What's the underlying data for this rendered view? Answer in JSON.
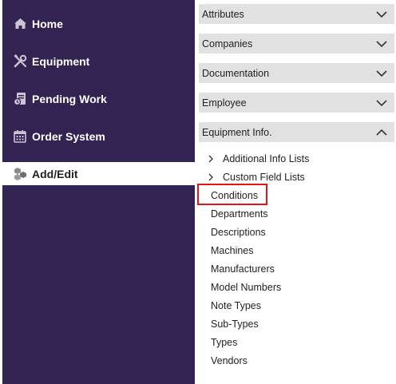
{
  "sidebar": {
    "items": [
      {
        "label": "Home",
        "icon": "home-icon"
      },
      {
        "label": "Equipment",
        "icon": "tools-icon"
      },
      {
        "label": "Pending Work",
        "icon": "pending-work-icon"
      },
      {
        "label": "Order System",
        "icon": "calendar-icon"
      },
      {
        "label": "Add/Edit",
        "icon": "cubes-icon",
        "active": true
      }
    ],
    "background": "#322352"
  },
  "accordion": {
    "sections": [
      {
        "label": "Attributes",
        "expanded": false
      },
      {
        "label": "Companies",
        "expanded": false
      },
      {
        "label": "Documentation",
        "expanded": false
      },
      {
        "label": "Employee",
        "expanded": false
      },
      {
        "label": "Equipment Info.",
        "expanded": true
      }
    ],
    "groups": [
      {
        "label": "Additional Info Lists"
      },
      {
        "label": "Custom Field Lists"
      }
    ],
    "items": [
      "Conditions",
      "Departments",
      "Descriptions",
      "Machines",
      "Manufacturers",
      "Model Numbers",
      "Note Types",
      "Sub-Types",
      "Types",
      "Vendors"
    ],
    "highlighted_item": "Conditions",
    "highlight_color": "#e2141c"
  }
}
